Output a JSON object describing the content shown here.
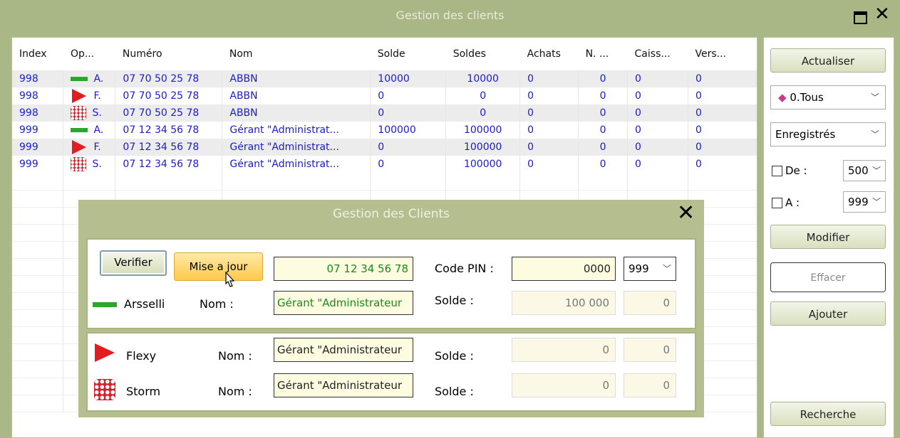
{
  "window": {
    "title": "Gestion des clients"
  },
  "grid": {
    "headers": [
      "Index",
      "Op...",
      "Numéro",
      "Nom",
      "Solde",
      "Soldes",
      "Achats",
      "N. ...",
      "Caiss...",
      "Vers..."
    ],
    "rows": [
      {
        "index": "998",
        "op_icon": "green-bar-icon",
        "op": "A.",
        "numero": "07 70 50 25 78",
        "nom": "ABBN",
        "solde": "10000",
        "soldes": "10000",
        "achats": "0",
        "n": "0",
        "caiss": "0",
        "vers": "0"
      },
      {
        "index": "998",
        "op_icon": "red-play-icon",
        "op": "F.",
        "numero": "07 70 50 25 78",
        "nom": "ABBN",
        "solde": "0",
        "soldes": "0",
        "achats": "0",
        "n": "0",
        "caiss": "0",
        "vers": "0"
      },
      {
        "index": "998",
        "op_icon": "red-dots-icon",
        "op": "S.",
        "numero": "07 70 50 25 78",
        "nom": "ABBN",
        "solde": "0",
        "soldes": "0",
        "achats": "0",
        "n": "0",
        "caiss": "0",
        "vers": "0"
      },
      {
        "index": "999",
        "op_icon": "green-bar-icon",
        "op": "A.",
        "numero": "07 12 34 56 78",
        "nom": "Gérant \"Administrat...",
        "solde": "100000",
        "soldes": "100000",
        "achats": "0",
        "n": "0",
        "caiss": "0",
        "vers": "0"
      },
      {
        "index": "999",
        "op_icon": "red-play-icon",
        "op": "F.",
        "numero": "07 12 34 56 78",
        "nom": "Gérant \"Administrat...",
        "solde": "0",
        "soldes": "100000",
        "achats": "0",
        "n": "0",
        "caiss": "0",
        "vers": "0"
      },
      {
        "index": "999",
        "op_icon": "red-dots-icon",
        "op": "S.",
        "numero": "07 12 34 56 78",
        "nom": "Gérant \"Administrat...",
        "solde": "0",
        "soldes": "100000",
        "achats": "0",
        "n": "0",
        "caiss": "0",
        "vers": "0"
      }
    ]
  },
  "side": {
    "actualiser": "Actualiser",
    "operator_filter": "0.Tous",
    "status_filter": "Enregistrés",
    "de_label": "De :",
    "de_value": "500",
    "a_label": "A :",
    "a_value": "999",
    "modifier": "Modifier",
    "effacer": "Effacer",
    "ajouter": "Ajouter",
    "recherche": "Recherche"
  },
  "dialog": {
    "title": "Gestion des Clients",
    "verifier": "Verifier",
    "mise_a_jour": "Mise a jour",
    "numero": "07 12 34 56 78",
    "code_pin_label": "Code PIN :",
    "code_pin": "0000",
    "pin_select": "999",
    "nom_label": "Nom :",
    "solde_label": "Solde :",
    "arsselli": {
      "name": "Arsselli",
      "nom": "Gérant \"Administrateur",
      "solde": "100 000",
      "extra": "0"
    },
    "flexy": {
      "name": "Flexy",
      "nom": "Gérant \"Administrateur",
      "solde": "0",
      "extra": "0"
    },
    "storm": {
      "name": "Storm",
      "nom": "Gérant \"Administrateur",
      "solde": "0",
      "extra": "0"
    }
  }
}
